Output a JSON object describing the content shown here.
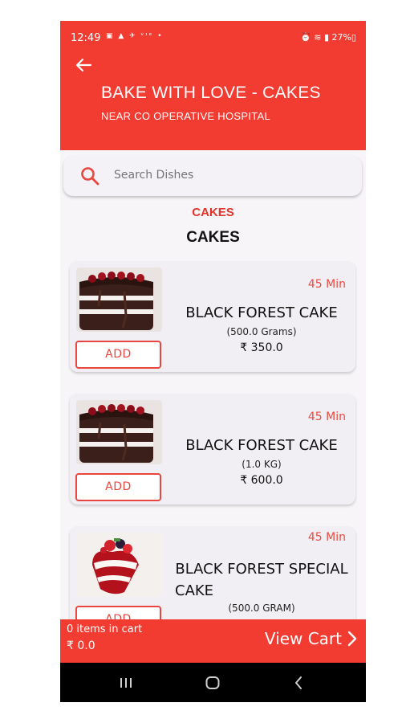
{
  "status_bar": {
    "time": "12:49",
    "left_icons": "▣ ▲ ✈ ᵛᶦᵉ •",
    "right_icons": "⏰ ≋ ▮ 27%▯"
  },
  "header": {
    "title": "BAKE WITH LOVE - CAKES",
    "subtitle": "NEAR CO OPERATIVE HOSPITAL",
    "background_color": "#f23b31"
  },
  "search": {
    "placeholder": "Search Dishes"
  },
  "category": {
    "label": "CAKES",
    "title": "CAKES"
  },
  "items": [
    {
      "name": "BLACK FOREST CAKE",
      "quantity": "(500.0 Grams)",
      "price": "₹ 350.0",
      "time": "45 Min",
      "add_label": "ADD",
      "image": "black-forest-cake-image"
    },
    {
      "name": "BLACK FOREST CAKE",
      "quantity": "(1.0 KG)",
      "price": "₹ 600.0",
      "time": "45 Min",
      "add_label": "ADD",
      "image": "black-forest-cake-image"
    },
    {
      "name": "BLACK FOREST SPECIAL CAKE",
      "name_line1": "BLACK FOREST SPECIAL",
      "name_line2": "CAKE",
      "quantity": "(500.0 GRAM)",
      "price": "",
      "time": "45 Min",
      "add_label": "ADD",
      "image": "red-velvet-heart-cake-image"
    }
  ],
  "cart": {
    "items_text": "0 items in cart",
    "total": "₹ 0.0",
    "view_label": "View Cart"
  },
  "nav": {
    "recents_icon": "recents-icon",
    "home_icon": "home-icon",
    "back_icon": "back-nav-icon"
  }
}
